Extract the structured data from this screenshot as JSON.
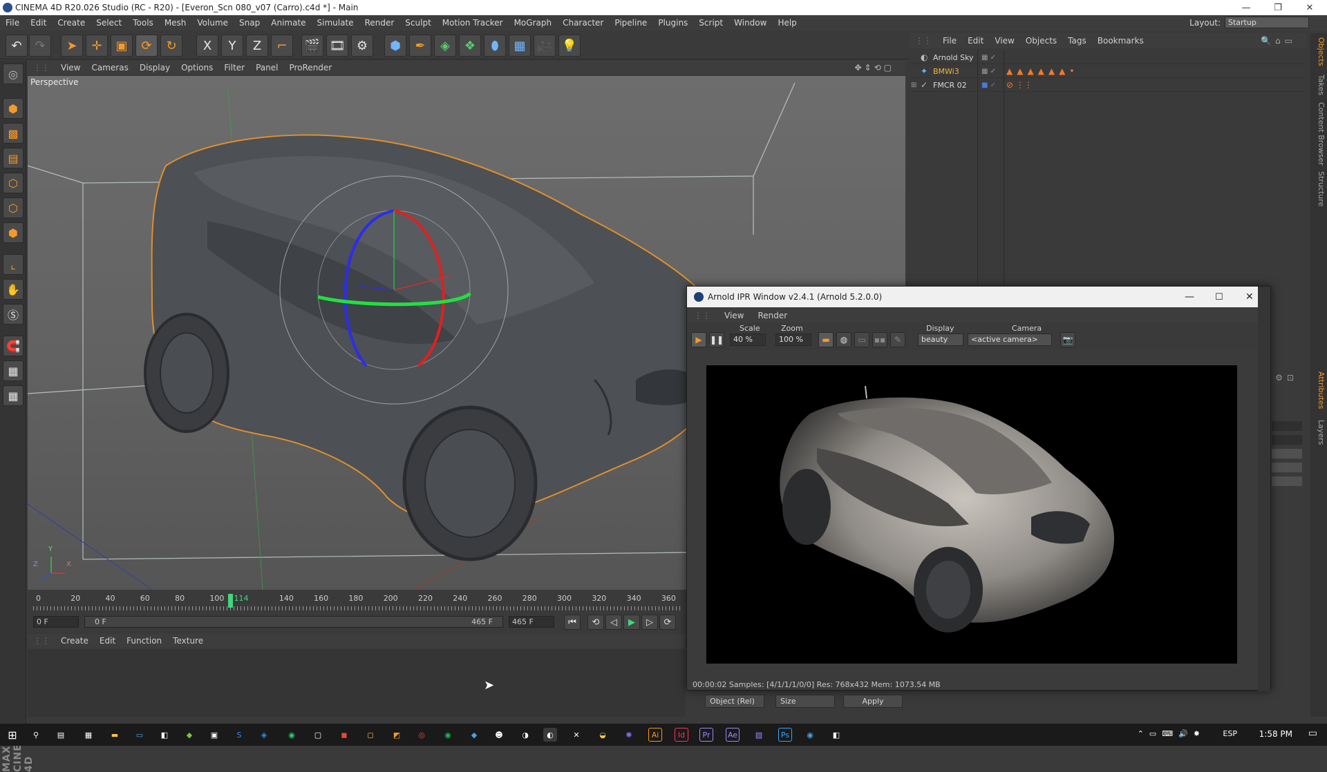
{
  "window": {
    "title": "CINEMA 4D R20.026 Studio (RC - R20) - [Everon_Scn 080_v07 (Carro).c4d *] - Main",
    "minimize": "—",
    "maximize": "❐",
    "close": "✕"
  },
  "menubar": {
    "items": [
      "File",
      "Edit",
      "Create",
      "Select",
      "Tools",
      "Mesh",
      "Volume",
      "Snap",
      "Animate",
      "Simulate",
      "Render",
      "Sculpt",
      "Motion Tracker",
      "MoGraph",
      "Character",
      "Pipeline",
      "Plugins",
      "Script",
      "Window",
      "Help"
    ],
    "layout_label": "Layout:",
    "layout_value": "Startup"
  },
  "toolbar": {
    "axis_x": "X",
    "axis_y": "Y",
    "axis_z": "Z"
  },
  "viewport": {
    "menu": [
      "View",
      "Cameras",
      "Display",
      "Options",
      "Filter",
      "Panel",
      "ProRender"
    ],
    "label": "Perspective",
    "axes": {
      "x": "X",
      "y": "Y",
      "z": "Z"
    }
  },
  "timeline": {
    "ticks": [
      "0",
      "20",
      "40",
      "60",
      "80",
      "100",
      "114",
      "140",
      "160",
      "180",
      "200",
      "220",
      "240",
      "260",
      "280",
      "300",
      "320",
      "340",
      "360"
    ],
    "current_frame": 114,
    "start_field": "0 F",
    "range_start": "0 F",
    "range_end": "465 F",
    "end_field": "465 F"
  },
  "material": {
    "menu": [
      "Create",
      "Edit",
      "Function",
      "Texture"
    ]
  },
  "objects": {
    "menu": [
      "File",
      "Edit",
      "View",
      "Objects",
      "Tags",
      "Bookmarks"
    ],
    "rows": [
      {
        "name": "Arnold Sky",
        "color": "#d8d8d8"
      },
      {
        "name": "BMWi3",
        "color": "#f3b43a"
      },
      {
        "name": "FMCR 02",
        "color": "#d8d8d8"
      }
    ]
  },
  "side_tabs": {
    "top": [
      "Objects",
      "Takes",
      "Content Browser",
      "Structure"
    ],
    "bottom": [
      "Attributes",
      "Layers"
    ]
  },
  "ipr": {
    "title": "Arnold IPR Window v2.4.1 (Arnold 5.2.0.0)",
    "menu": [
      "View",
      "Render"
    ],
    "scale_label": "Scale",
    "scale_value": "40 %",
    "zoom_label": "Zoom",
    "zoom_value": "100 %",
    "display_label": "Display",
    "display_value": "beauty",
    "camera_label": "Camera",
    "camera_value": "<active camera>",
    "status": "00:00:02  Samples: [4/1/1/1/0/0]  Res: 768x432  Mem: 1073.54 MB"
  },
  "attr_bar": {
    "object_rel": "Object (Rel)",
    "size": "Size",
    "apply": "Apply"
  },
  "taskbar": {
    "lang": "ESP",
    "time": "1:58 PM"
  },
  "colors": {
    "accent": "#f39a2c",
    "selection_orange": "#e0902c",
    "timeline_marker": "#3fd87a"
  }
}
